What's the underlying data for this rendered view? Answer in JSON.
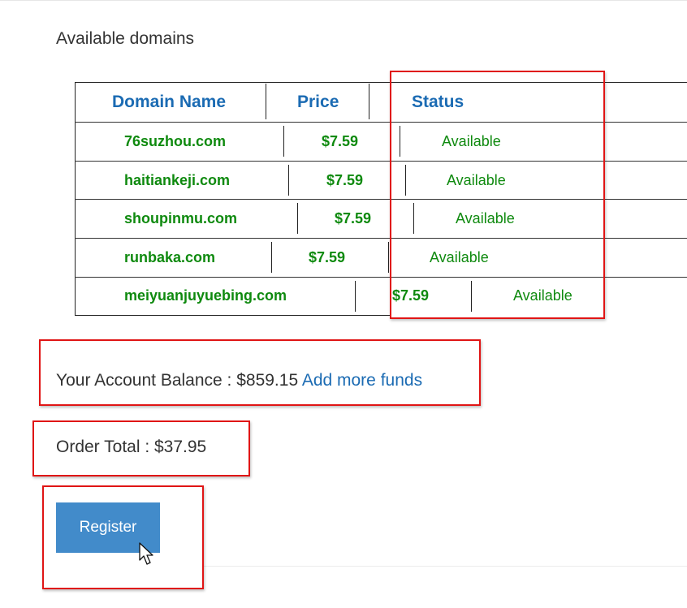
{
  "page": {
    "heading": "Available domains"
  },
  "table": {
    "headers": {
      "domain": "Domain Name",
      "price": "Price",
      "status": "Status"
    },
    "rows": [
      {
        "domain": "76suzhou.com",
        "price": "$7.59",
        "status": "Available"
      },
      {
        "domain": "haitiankeji.com",
        "price": "$7.59",
        "status": "Available"
      },
      {
        "domain": "shoupinmu.com",
        "price": "$7.59",
        "status": "Available"
      },
      {
        "domain": "runbaka.com",
        "price": "$7.59",
        "status": "Available"
      },
      {
        "domain": "meiyuanjuyuebing.com",
        "price": "$7.59",
        "status": "Available"
      }
    ]
  },
  "account": {
    "balance_label": "Your Account Balance : $859.15",
    "add_funds_link": "Add more funds"
  },
  "order": {
    "total_label": "Order Total : $37.95"
  },
  "actions": {
    "register_label": "Register"
  },
  "colors": {
    "highlight": "#e01515",
    "header_text": "#1b6bb3",
    "domain_text": "#0f8a0f",
    "button_bg": "#428bca"
  }
}
